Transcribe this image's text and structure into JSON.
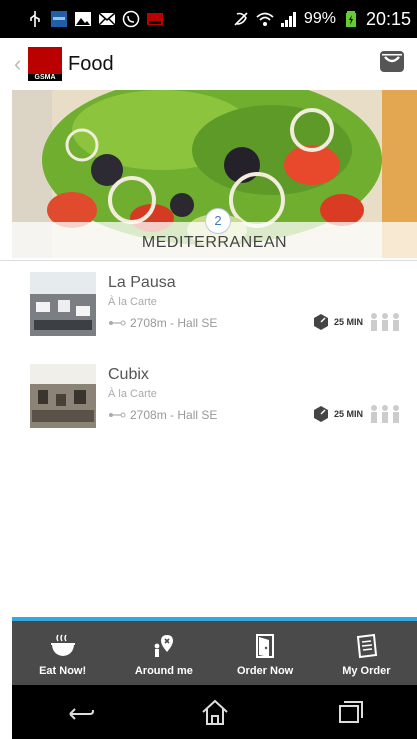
{
  "status_bar": {
    "battery": "99%",
    "time": "20:15",
    "icons": [
      "usb-icon",
      "app-notification-icon",
      "image-icon",
      "mail-icon",
      "whatsapp-icon",
      "app-notification-icon",
      "mute-icon",
      "wifi-icon",
      "signal-icon",
      "battery-icon"
    ]
  },
  "header": {
    "title": "Food",
    "logo_text": "GSMA",
    "icons": [
      "back-chevron-icon",
      "cart-icon"
    ]
  },
  "banner": {
    "category": "MEDITERRANEAN",
    "count": "2"
  },
  "restaurants": [
    {
      "name": "La Pausa",
      "type": "À la Carte",
      "location": "2708m - Hall SE",
      "wait": "25 MIN"
    },
    {
      "name": "Cubix",
      "type": "À la Carte",
      "location": "2708m - Hall SE",
      "wait": "25 MIN"
    }
  ],
  "bottom_nav": [
    {
      "label": "Eat Now!",
      "icon": "bowl-icon"
    },
    {
      "label": "Around me",
      "icon": "location-person-icon"
    },
    {
      "label": "Order Now",
      "icon": "door-icon",
      "active": true
    },
    {
      "label": "My Order",
      "icon": "list-icon"
    }
  ],
  "colors": {
    "accent": "#33a8e0",
    "nav_bg": "#4a4a4a",
    "status_bar": "#000000"
  }
}
